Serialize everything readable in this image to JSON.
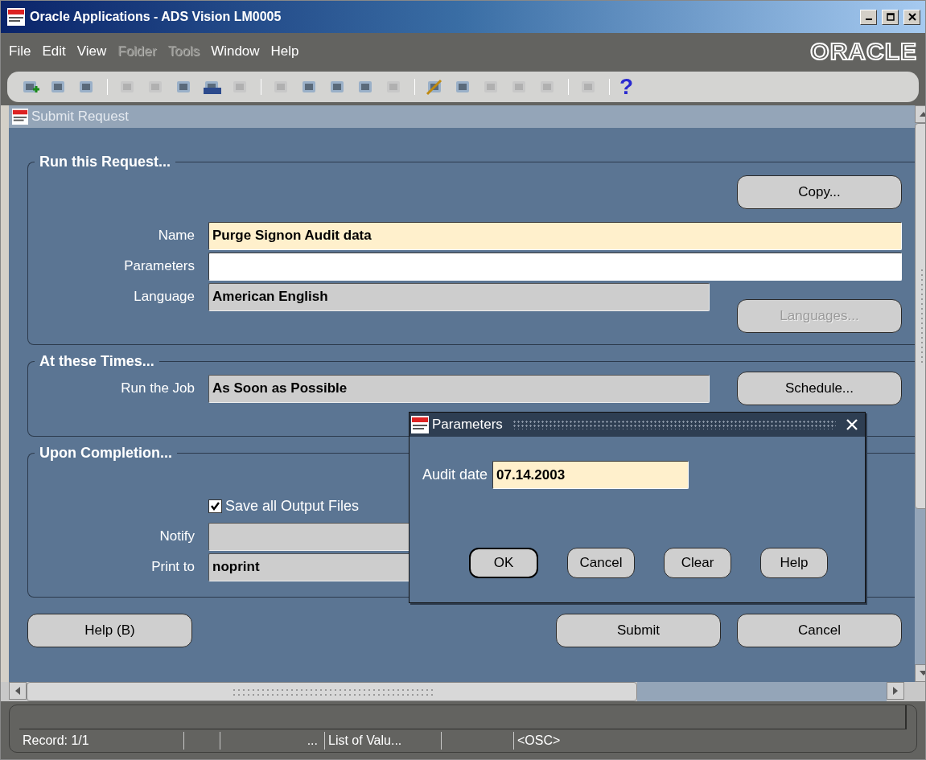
{
  "window": {
    "title": "Oracle Applications - ADS Vision LM0005"
  },
  "menu": [
    {
      "label": "File",
      "disabled": false
    },
    {
      "label": "Edit",
      "disabled": false
    },
    {
      "label": "View",
      "disabled": false
    },
    {
      "label": "Folder",
      "disabled": true
    },
    {
      "label": "Tools",
      "disabled": true
    },
    {
      "label": "Window",
      "disabled": false
    },
    {
      "label": "Help",
      "disabled": false
    }
  ],
  "brand": "ORACLE",
  "toolbar": {
    "help": "?"
  },
  "form": {
    "title": "Submit Request",
    "run_request": {
      "legend": "Run this Request...",
      "copy_button": {
        "label": "Copy...",
        "disabled": false
      },
      "fields": [
        {
          "label": "Name",
          "value": "Purge Signon Audit data",
          "kind": "required"
        },
        {
          "label": "Parameters",
          "kind": "optional"
        },
        {
          "label": "Language",
          "value": "American English",
          "kind": "readonly"
        }
      ],
      "languages_button": {
        "label": "Languages...",
        "disabled": true
      }
    },
    "times": {
      "legend": "At these Times...",
      "field": {
        "label": "Run the Job",
        "value": "As Soon as Possible",
        "kind": "readonly"
      },
      "schedule_button": {
        "label": "Schedule...",
        "disabled": false
      }
    },
    "completion": {
      "legend": "Upon Completion...",
      "save_output": {
        "label": "Save all Output Files",
        "checked": true
      },
      "fields": [
        {
          "label": "Notify",
          "kind": "readonly"
        },
        {
          "label": "Print to",
          "value": "noprint",
          "kind": "readonly"
        }
      ]
    },
    "buttons": [
      {
        "label": "Help (B)",
        "disabled": false
      },
      {
        "label": "Submit",
        "disabled": false
      },
      {
        "label": "Cancel",
        "disabled": false
      }
    ]
  },
  "dialog": {
    "title": "Parameters",
    "field": {
      "label": "Audit date",
      "value": "07.14.2003",
      "kind": "required"
    },
    "buttons": [
      {
        "label": "OK",
        "default": true
      },
      {
        "label": "Cancel",
        "default": false
      },
      {
        "label": "Clear",
        "default": false
      },
      {
        "label": "Help",
        "default": false
      }
    ]
  },
  "status_bar": {
    "cells": [
      "Record: 1/1",
      "...",
      "List of Valu...",
      "<OSC>"
    ]
  }
}
